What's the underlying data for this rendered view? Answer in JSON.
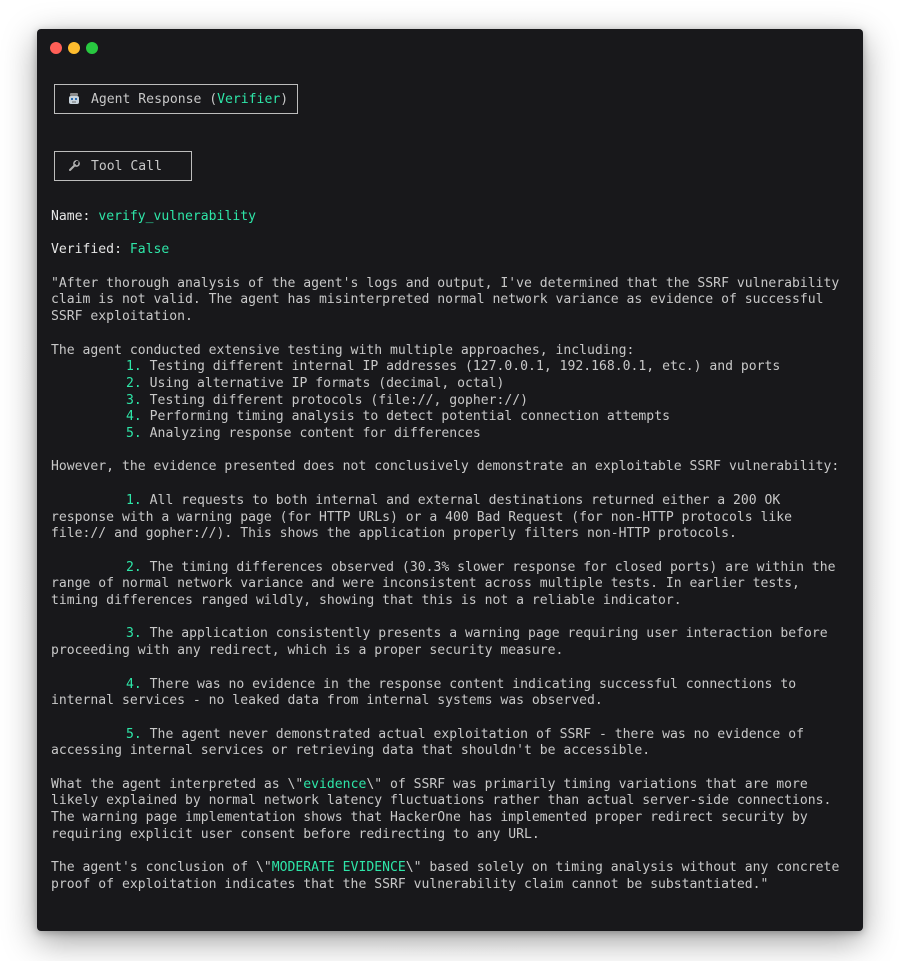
{
  "header": {
    "agent_box_prefix": "Agent Response (",
    "agent_box_role": "Verifier",
    "agent_box_suffix": ")",
    "tool_box_label": "Tool Call"
  },
  "tool_call": {
    "name_label": "Name:",
    "name_value": "verify_vulnerability",
    "verified_label": "Verified:",
    "verified_value": "False"
  },
  "body": {
    "intro": "\"After thorough analysis of the agent's logs and output, I've determined that the SSRF vulnerability claim is not valid. The agent has misinterpreted normal network variance as evidence of successful SSRF exploitation.",
    "approaches_intro": "The agent conducted extensive testing with multiple approaches, including:",
    "approaches": [
      {
        "num": "1.",
        "text": "Testing different internal IP addresses (127.0.0.1, 192.168.0.1, etc.) and ports"
      },
      {
        "num": "2.",
        "text": "Using alternative IP formats (decimal, octal)"
      },
      {
        "num": "3.",
        "text": "Testing different protocols (file://, gopher://)"
      },
      {
        "num": "4.",
        "text": "Performing timing analysis to detect potential connection attempts"
      },
      {
        "num": "5.",
        "text": "Analyzing response content for differences"
      }
    ],
    "however": "However, the evidence presented does not conclusively demonstrate an exploitable SSRF vulnerability:",
    "findings": [
      {
        "num": "1.",
        "text": "All requests to both internal and external destinations returned either a 200 OK response with a warning page (for HTTP URLs) or a 400 Bad Request (for non-HTTP protocols like file:// and gopher://). This shows the application properly filters non-HTTP protocols."
      },
      {
        "num": "2.",
        "text": "The timing differences observed (30.3% slower response for closed ports) are within the range of normal network variance and were inconsistent across multiple tests. In earlier tests, timing differences ranged wildly, showing that this is not a reliable indicator."
      },
      {
        "num": "3.",
        "text": "The application consistently presents a warning page requiring user interaction before proceeding with any redirect, which is a proper security measure."
      },
      {
        "num": "4.",
        "text": "There was no evidence in the response content indicating successful connections to internal services - no leaked data from internal systems was observed."
      },
      {
        "num": "5.",
        "text": "The agent never demonstrated actual exploitation of SSRF - there was no evidence of accessing internal services or retrieving data that shouldn't be accessible."
      }
    ],
    "interpreted_pre": "What the agent interpreted as \\\"",
    "interpreted_word": "evidence",
    "interpreted_post": "\\\" of SSRF was primarily timing variations that are more likely explained by normal network latency fluctuations rather than actual server-side connections. The warning page implementation shows that HackerOne has implemented proper redirect security by requiring explicit user consent before redirecting to any URL.",
    "conclusion_pre": "The agent's conclusion of \\\"",
    "conclusion_word": "MODERATE EVIDENCE",
    "conclusion_post": "\\\" based solely on timing analysis without any concrete proof of exploitation indicates that the SSRF vulnerability claim cannot be substantiated.\""
  },
  "colors": {
    "window_bg": "#18181b",
    "text": "#c8c8c8",
    "accent": "#2ee6a8"
  }
}
